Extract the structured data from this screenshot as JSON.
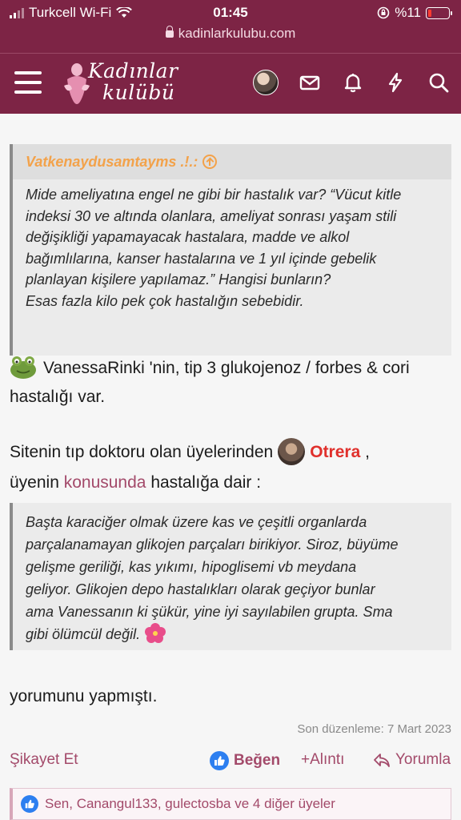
{
  "status": {
    "carrier": "Turkcell Wi-Fi",
    "time": "01:45",
    "battery": "%11"
  },
  "url": "kadinlarkulubu.com",
  "nav": {
    "logo_line1": "Kadınlar",
    "logo_line2": "kulübü"
  },
  "quote1": {
    "author": "Vatkenaydusamtayms .!.:",
    "lines": [
      "Mide ameliyatına engel ne gibi bir hastalık var? “Vücut kitle",
      "indeksi 30 ve altında olanlara, ameliyat sonrası yaşam stili",
      "değişikliği yapamayacak hastalara, madde ve alkol",
      "bağımlılarına, kanser hastalarına ve 1 yıl içinde gebelik",
      "planlayan kişilere yapılamaz.” Hangisi bunların?",
      "Esas fazla kilo pek çok hastalığın sebebidir."
    ]
  },
  "post": {
    "mention_user": "VanessaRinki",
    "para1_text": " 'nin, tip 3 glukojenoz / forbes & cori hastalığı var.",
    "para2_before": "Sitenin tıp doktoru olan üyelerinden",
    "doctor_user": "Otrera",
    "para2_mid": " ,",
    "para2_line2_before": "üyenin ",
    "link_text": "konusunda",
    "para2_after": " hastalığa dair :",
    "quote2_lines": [
      "Başta karaciğer olmak üzere kas ve çeşitli organlarda",
      "parçalanamayan glikojen parçaları birikiyor. Siroz, büyüme",
      "gelişme geriliği, kas yıkımı, hipoglisemi vb meydana",
      "geliyor. Glikojen depo hastalıkları olarak geçiyor bunlar",
      "ama Vanessanın ki şükür, yine iyi sayılabilen grupta. Sma",
      "gibi ölümcül değil."
    ],
    "para3": "yorumunu yapmıştı.",
    "edited": "Son düzenleme: 7 Mart 2023"
  },
  "actions": {
    "report": "Şikayet Et",
    "like": "Beğen",
    "quote": "+Alıntı",
    "reply": "Yorumla"
  },
  "likes": "Sen, Canangul133, gulectosba ve 4 diğer üyeler",
  "colors": {
    "header": "#7d2445",
    "accent_link": "#a34a6a",
    "author_orange": "#f3a24a",
    "mention_red": "#e0302c",
    "like_blue": "#2d7ff0"
  }
}
